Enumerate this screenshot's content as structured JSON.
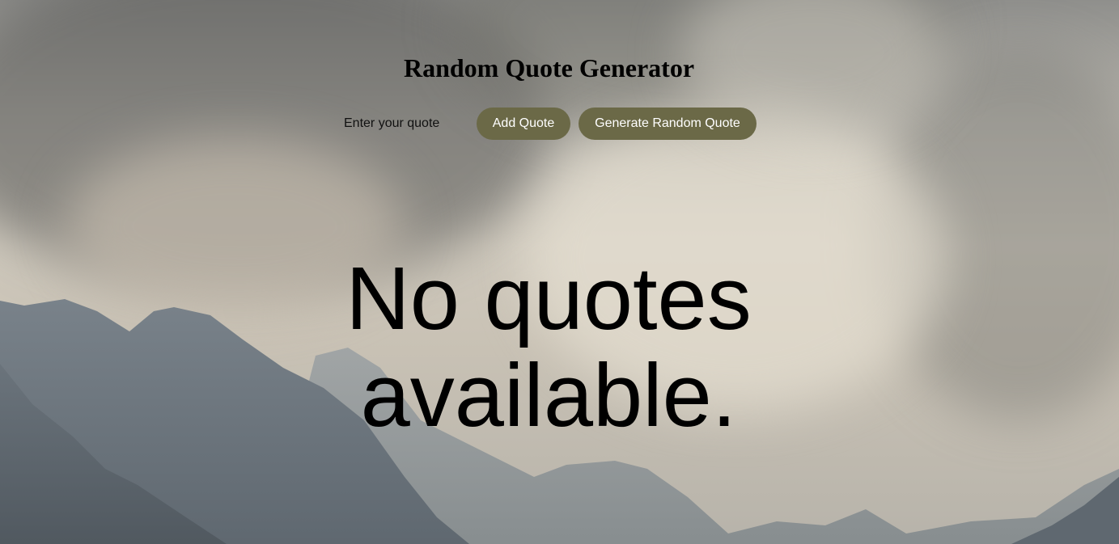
{
  "page": {
    "title": "Random Quote Generator"
  },
  "form": {
    "quote_input": {
      "placeholder": "Enter your quote",
      "value": ""
    },
    "add_button_label": "Add Quote",
    "generate_button_label": "Generate Random Quote"
  },
  "quote_display": {
    "text": "No quotes available."
  },
  "colors": {
    "button_background": "#6b6947",
    "button_text": "#ffffff",
    "text": "#000000"
  },
  "background": {
    "icon": "mountain-landscape-photo"
  }
}
